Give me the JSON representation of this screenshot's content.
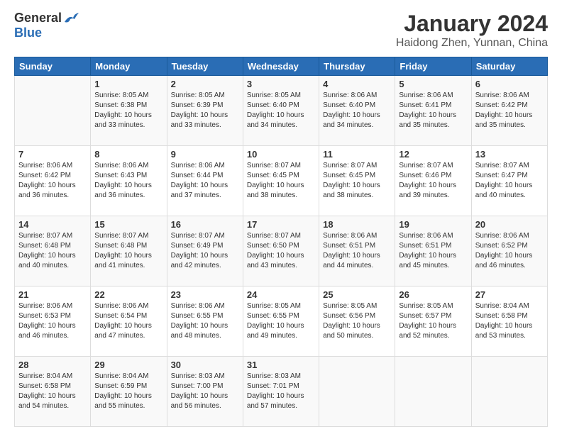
{
  "logo": {
    "general": "General",
    "blue": "Blue"
  },
  "title": "January 2024",
  "subtitle": "Haidong Zhen, Yunnan, China",
  "days": [
    "Sunday",
    "Monday",
    "Tuesday",
    "Wednesday",
    "Thursday",
    "Friday",
    "Saturday"
  ],
  "weeks": [
    [
      {
        "day": "",
        "info": ""
      },
      {
        "day": "1",
        "info": "Sunrise: 8:05 AM\nSunset: 6:38 PM\nDaylight: 10 hours\nand 33 minutes."
      },
      {
        "day": "2",
        "info": "Sunrise: 8:05 AM\nSunset: 6:39 PM\nDaylight: 10 hours\nand 33 minutes."
      },
      {
        "day": "3",
        "info": "Sunrise: 8:05 AM\nSunset: 6:40 PM\nDaylight: 10 hours\nand 34 minutes."
      },
      {
        "day": "4",
        "info": "Sunrise: 8:06 AM\nSunset: 6:40 PM\nDaylight: 10 hours\nand 34 minutes."
      },
      {
        "day": "5",
        "info": "Sunrise: 8:06 AM\nSunset: 6:41 PM\nDaylight: 10 hours\nand 35 minutes."
      },
      {
        "day": "6",
        "info": "Sunrise: 8:06 AM\nSunset: 6:42 PM\nDaylight: 10 hours\nand 35 minutes."
      }
    ],
    [
      {
        "day": "7",
        "info": "Sunrise: 8:06 AM\nSunset: 6:42 PM\nDaylight: 10 hours\nand 36 minutes."
      },
      {
        "day": "8",
        "info": "Sunrise: 8:06 AM\nSunset: 6:43 PM\nDaylight: 10 hours\nand 36 minutes."
      },
      {
        "day": "9",
        "info": "Sunrise: 8:06 AM\nSunset: 6:44 PM\nDaylight: 10 hours\nand 37 minutes."
      },
      {
        "day": "10",
        "info": "Sunrise: 8:07 AM\nSunset: 6:45 PM\nDaylight: 10 hours\nand 38 minutes."
      },
      {
        "day": "11",
        "info": "Sunrise: 8:07 AM\nSunset: 6:45 PM\nDaylight: 10 hours\nand 38 minutes."
      },
      {
        "day": "12",
        "info": "Sunrise: 8:07 AM\nSunset: 6:46 PM\nDaylight: 10 hours\nand 39 minutes."
      },
      {
        "day": "13",
        "info": "Sunrise: 8:07 AM\nSunset: 6:47 PM\nDaylight: 10 hours\nand 40 minutes."
      }
    ],
    [
      {
        "day": "14",
        "info": "Sunrise: 8:07 AM\nSunset: 6:48 PM\nDaylight: 10 hours\nand 40 minutes."
      },
      {
        "day": "15",
        "info": "Sunrise: 8:07 AM\nSunset: 6:48 PM\nDaylight: 10 hours\nand 41 minutes."
      },
      {
        "day": "16",
        "info": "Sunrise: 8:07 AM\nSunset: 6:49 PM\nDaylight: 10 hours\nand 42 minutes."
      },
      {
        "day": "17",
        "info": "Sunrise: 8:07 AM\nSunset: 6:50 PM\nDaylight: 10 hours\nand 43 minutes."
      },
      {
        "day": "18",
        "info": "Sunrise: 8:06 AM\nSunset: 6:51 PM\nDaylight: 10 hours\nand 44 minutes."
      },
      {
        "day": "19",
        "info": "Sunrise: 8:06 AM\nSunset: 6:51 PM\nDaylight: 10 hours\nand 45 minutes."
      },
      {
        "day": "20",
        "info": "Sunrise: 8:06 AM\nSunset: 6:52 PM\nDaylight: 10 hours\nand 46 minutes."
      }
    ],
    [
      {
        "day": "21",
        "info": "Sunrise: 8:06 AM\nSunset: 6:53 PM\nDaylight: 10 hours\nand 46 minutes."
      },
      {
        "day": "22",
        "info": "Sunrise: 8:06 AM\nSunset: 6:54 PM\nDaylight: 10 hours\nand 47 minutes."
      },
      {
        "day": "23",
        "info": "Sunrise: 8:06 AM\nSunset: 6:55 PM\nDaylight: 10 hours\nand 48 minutes."
      },
      {
        "day": "24",
        "info": "Sunrise: 8:05 AM\nSunset: 6:55 PM\nDaylight: 10 hours\nand 49 minutes."
      },
      {
        "day": "25",
        "info": "Sunrise: 8:05 AM\nSunset: 6:56 PM\nDaylight: 10 hours\nand 50 minutes."
      },
      {
        "day": "26",
        "info": "Sunrise: 8:05 AM\nSunset: 6:57 PM\nDaylight: 10 hours\nand 52 minutes."
      },
      {
        "day": "27",
        "info": "Sunrise: 8:04 AM\nSunset: 6:58 PM\nDaylight: 10 hours\nand 53 minutes."
      }
    ],
    [
      {
        "day": "28",
        "info": "Sunrise: 8:04 AM\nSunset: 6:58 PM\nDaylight: 10 hours\nand 54 minutes."
      },
      {
        "day": "29",
        "info": "Sunrise: 8:04 AM\nSunset: 6:59 PM\nDaylight: 10 hours\nand 55 minutes."
      },
      {
        "day": "30",
        "info": "Sunrise: 8:03 AM\nSunset: 7:00 PM\nDaylight: 10 hours\nand 56 minutes."
      },
      {
        "day": "31",
        "info": "Sunrise: 8:03 AM\nSunset: 7:01 PM\nDaylight: 10 hours\nand 57 minutes."
      },
      {
        "day": "",
        "info": ""
      },
      {
        "day": "",
        "info": ""
      },
      {
        "day": "",
        "info": ""
      }
    ]
  ]
}
